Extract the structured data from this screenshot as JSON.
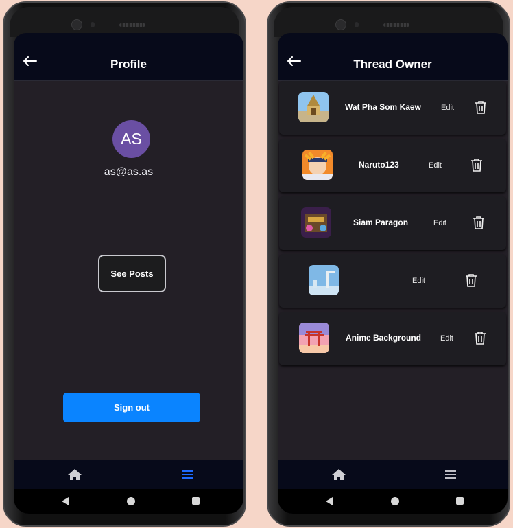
{
  "profile_screen": {
    "title": "Profile",
    "avatar_initials": "AS",
    "email": "as@as.as",
    "see_posts_label": "See Posts",
    "sign_out_label": "Sign out"
  },
  "thread_screen": {
    "title": "Thread Owner",
    "threads": [
      {
        "name": "Wat Pha Som Kaew",
        "edit_label": "Edit"
      },
      {
        "name": "Naruto123",
        "edit_label": "Edit"
      },
      {
        "name": "Siam Paragon",
        "edit_label": "Edit"
      },
      {
        "name": "",
        "edit_label": "Edit"
      },
      {
        "name": "Anime Background",
        "edit_label": "Edit"
      }
    ]
  },
  "nav_icons": [
    "home-icon",
    "menu-icon"
  ],
  "system_nav_icons": [
    "back-triangle-icon",
    "home-circle-icon",
    "recents-square-icon"
  ],
  "colors": {
    "background": "#f6d6c8",
    "screen": "#231f26",
    "appbar": "#070a1a",
    "accent_blue": "#0a84ff",
    "avatar": "#6a4fa3",
    "card": "#1e1d22"
  }
}
